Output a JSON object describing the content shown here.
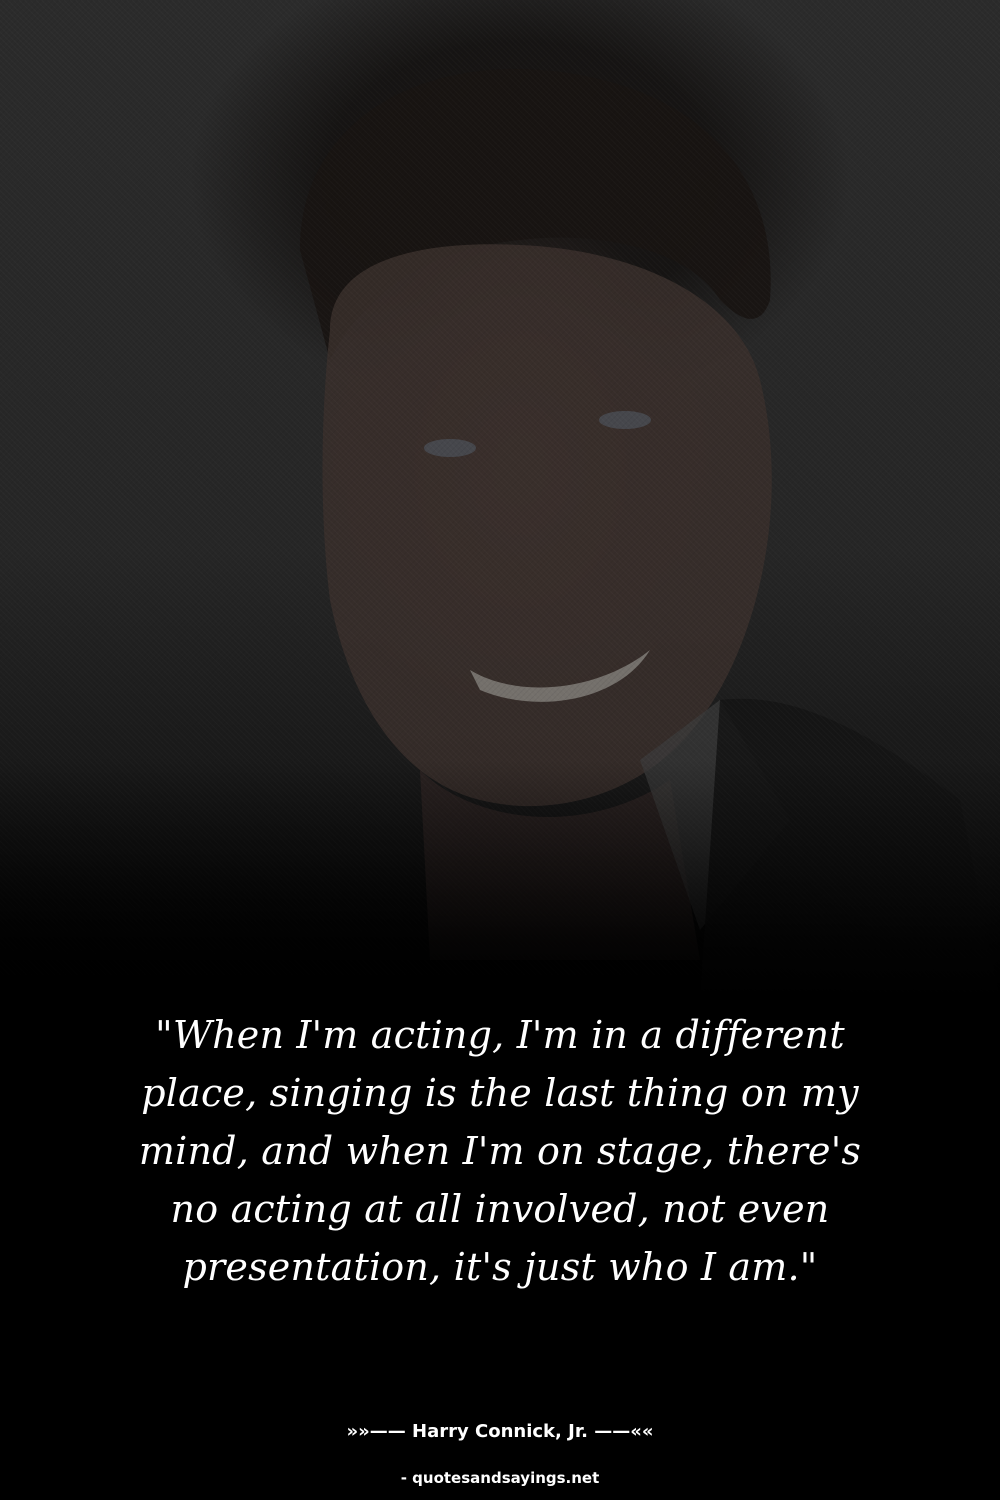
{
  "image": {
    "subject": "smiling-man-portrait",
    "background_color": "#2a2a2a",
    "overlay_color": "#000000"
  },
  "quote": {
    "text": "\"When I'm acting, I'm in a different place, singing is the last thing on my mind, and when I'm on stage, there's no acting at all involved, not even presentation, it's just who I am.\"",
    "color": "#ffffff"
  },
  "attribution": {
    "prefix": "»»—— ",
    "author": "Harry Connick, Jr.",
    "suffix": " ——««"
  },
  "source": {
    "text": "- quotesandsayings.net"
  }
}
